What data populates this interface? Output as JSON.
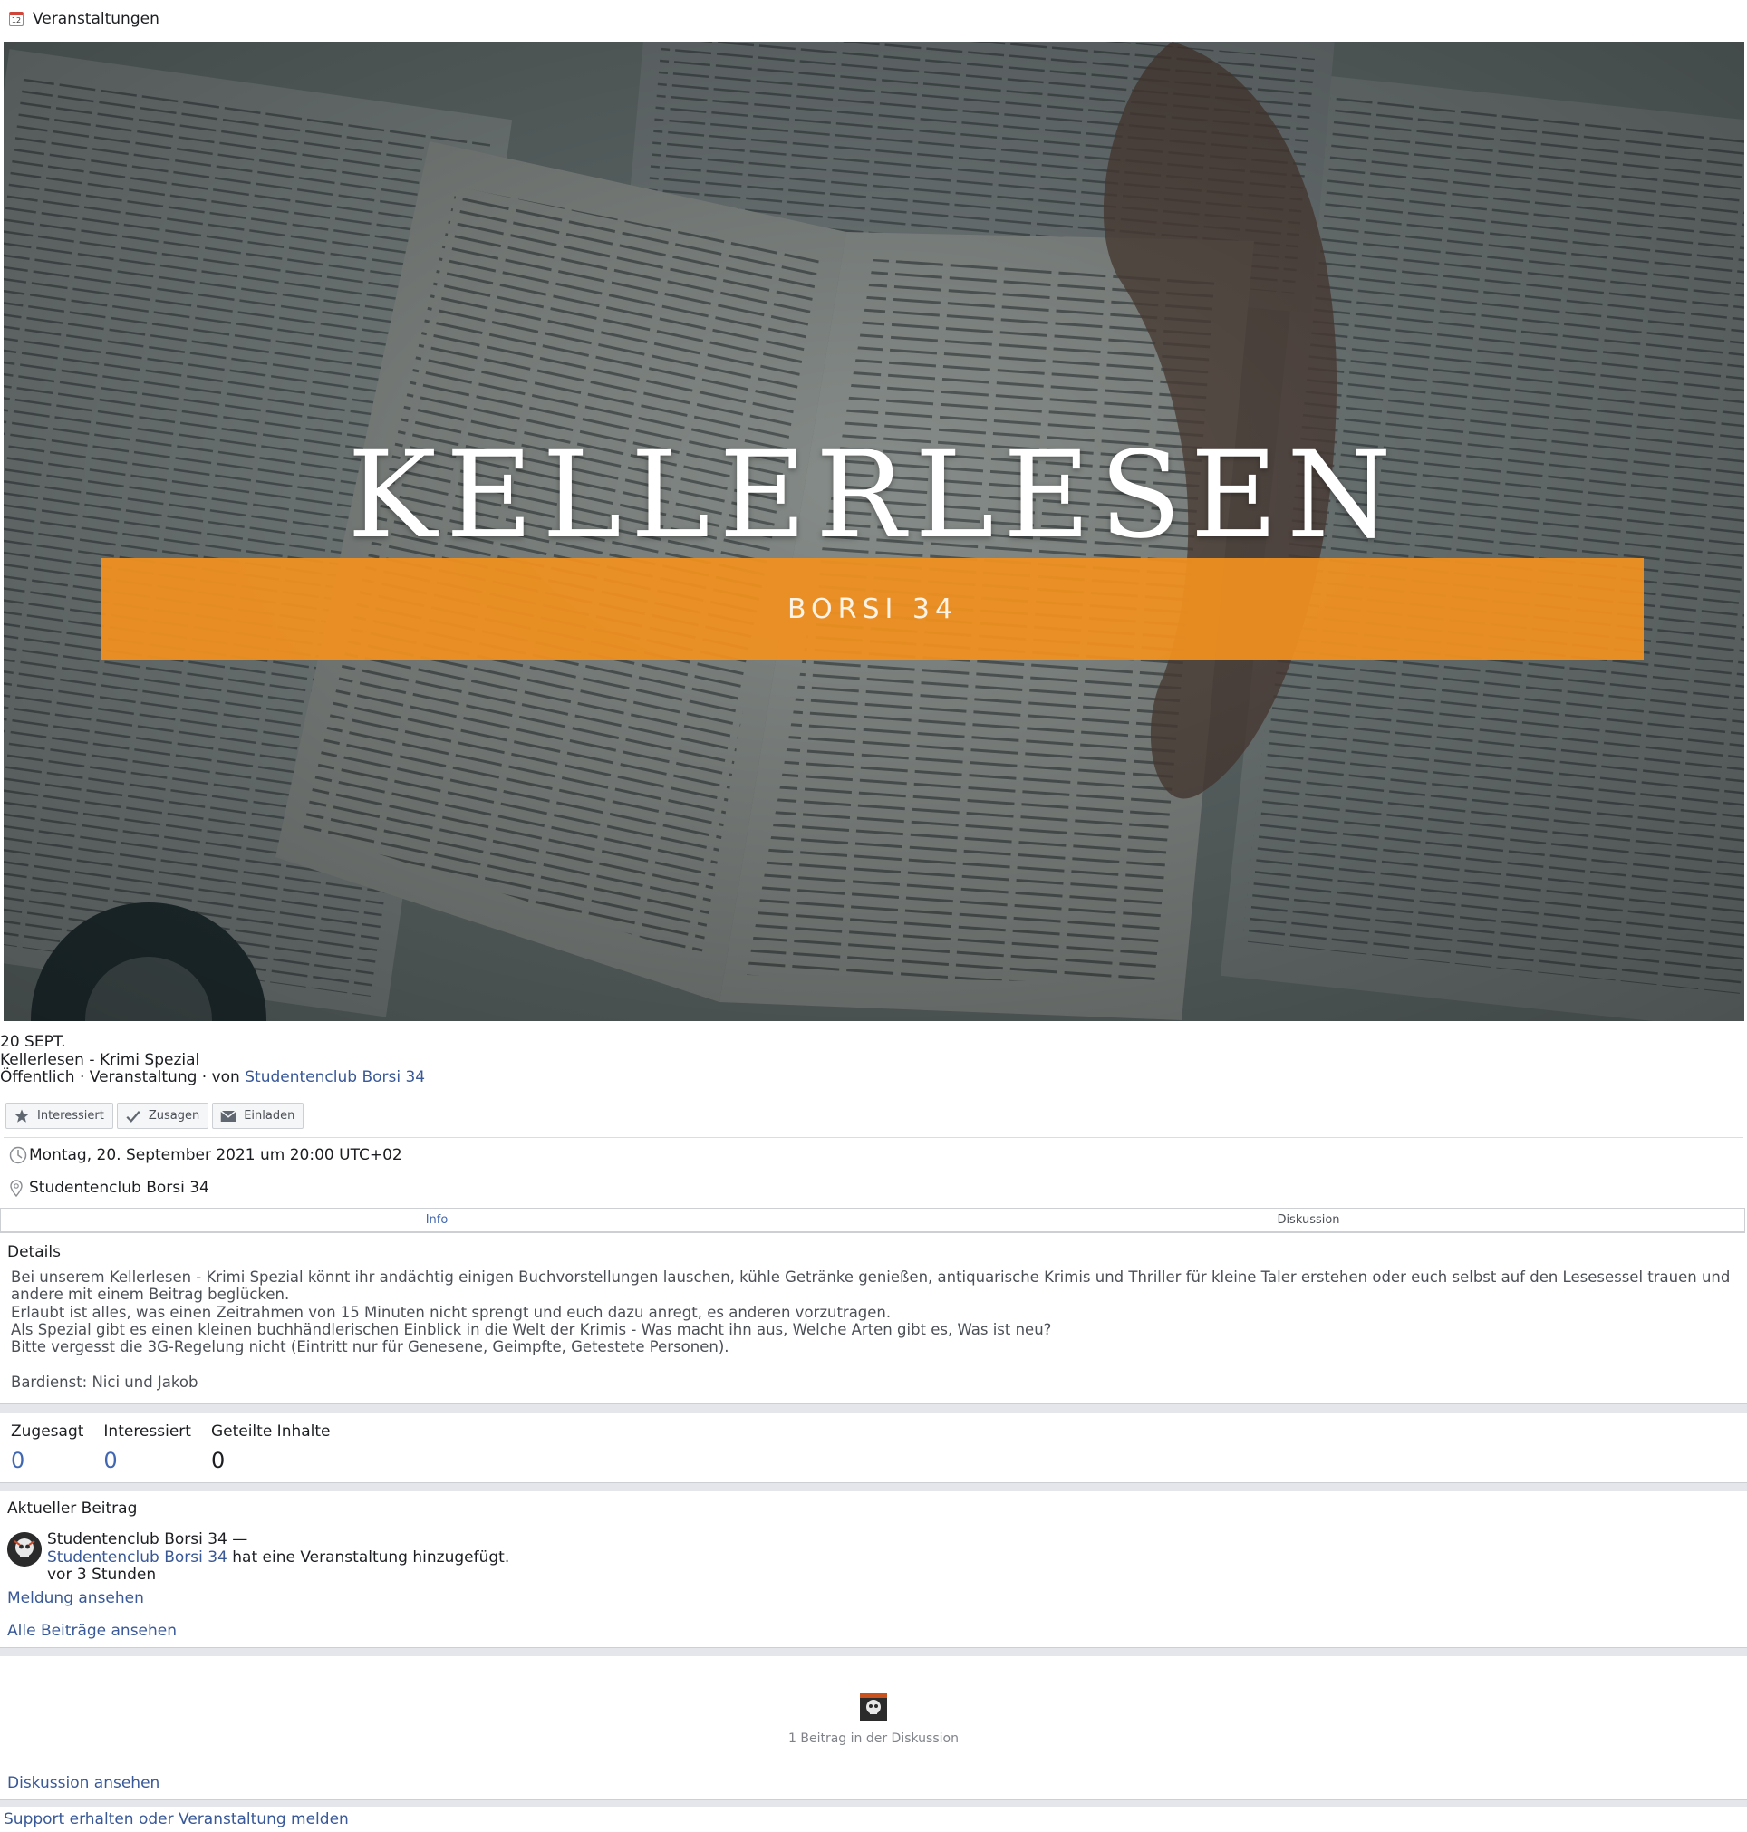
{
  "topbar": {
    "icon": "calendar-icon",
    "icon_text": "12",
    "title": "Veranstaltungen"
  },
  "banner": {
    "title": "KELLERLESEN",
    "subtitle": "BORSI 34",
    "strip_color": "#F1901E"
  },
  "event": {
    "date_short": "20 SEPT.",
    "name": "Kellerlesen - Krimi Spezial",
    "meta_prefix": "Öffentlich · Veranstaltung · von ",
    "host": "Studentenclub Borsi 34"
  },
  "actions": {
    "interested": {
      "label": "Interessiert",
      "icon": "star-icon"
    },
    "going": {
      "label": "Zusagen",
      "icon": "check-icon"
    },
    "invite": {
      "label": "Einladen",
      "icon": "envelope-icon"
    }
  },
  "when": {
    "icon": "clock-icon",
    "text": "Montag, 20. September 2021 um 20:00 UTC+02"
  },
  "where": {
    "icon": "location-pin-icon",
    "text": "Studentenclub Borsi 34"
  },
  "tabs": [
    {
      "label": "Info",
      "active": true
    },
    {
      "label": "Diskussion",
      "active": false
    }
  ],
  "details": {
    "heading": "Details",
    "body": "Bei unserem Kellerlesen - Krimi Spezial könnt ihr andächtig einigen Buchvorstellungen lauschen, kühle Getränke genießen, antiquarische Krimis und Thriller für kleine Taler erstehen oder euch selbst auf den Lesesessel trauen und andere mit einem Beitrag beglücken.\nErlaubt ist alles, was einen Zeitrahmen von 15 Minuten nicht sprengt und euch dazu anregt, es anderen vorzutragen.\nAls Spezial gibt es einen kleinen buchhändlerischen Einblick in die Welt der Krimis - Was macht ihn aus, Welche Arten gibt es, Was ist neu?\nBitte vergesst die 3G-Regelung nicht (Eintritt nur für Genesene, Geimpfte, Getestete Personen).\n\nBardienst: Nici und Jakob"
  },
  "stats": [
    {
      "label": "Zugesagt",
      "value": "0"
    },
    {
      "label": "Interessiert",
      "value": "0"
    },
    {
      "label": "Geteilte Inhalte",
      "value": "0"
    }
  ],
  "recent_post": {
    "heading": "Aktueller Beitrag",
    "author": "Studentenclub Borsi 34",
    "dash": " —",
    "actor": "Studentenclub Borsi 34",
    "action": " hat eine Veranstaltung hinzugefügt.",
    "time": "vor 3 Stunden",
    "view_report": "Meldung ansehen",
    "view_all": "Alle Beiträge ansehen"
  },
  "discussion": {
    "count_text": "1 Beitrag in der Diskussion",
    "view": "Diskussion ansehen"
  },
  "footer": {
    "support": "Support erhalten oder Veranstaltung melden"
  }
}
